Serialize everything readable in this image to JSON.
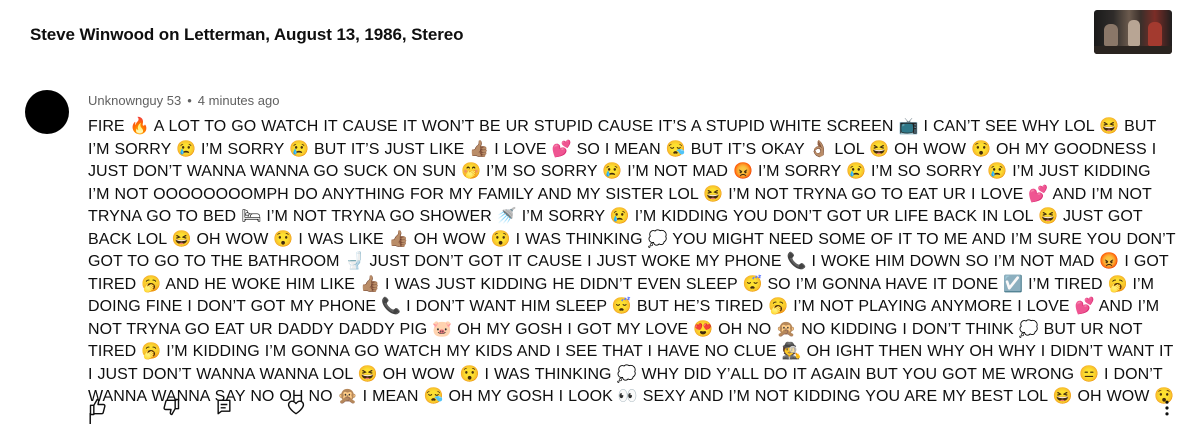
{
  "video": {
    "title": "Steve Winwood on Letterman, August 13, 1986, Stereo",
    "thumbnail_icon": "video-thumbnail"
  },
  "comment": {
    "author": "Unknownguy 53",
    "separator": "•",
    "time": "4 minutes ago",
    "text": "FIRE 🔥 A LOT TO GO WATCH IT CAUSE IT WON’T BE UR STUPID CAUSE IT’S A STUPID WHITE SCREEN 📺 I CAN’T SEE WHY LOL 😆 BUT I’M SORRY 😢 I’M SORRY 😢 BUT IT’S JUST LIKE 👍🏽 I LOVE 💕 SO I MEAN 😪 BUT IT’S OKAY 👌🏽 LOL 😆 OH WOW 😯 OH MY GOODNESS I JUST DON’T WANNA WANNA GO SUCK ON SUN 🤭 I’M SO SORRY 😢 I’M NOT MAD 😡 I’M SORRY 😢 I’M SO SORRY 😢 I’M JUST KIDDING I’M NOT OOOOOOOOMPH DO ANYTHING FOR MY FAMILY AND MY SISTER LOL 😆 I’M NOT TRYNA GO TO EAT UR I LOVE 💕 AND I’M NOT TRYNA GO TO BED 🛏 I’M NOT TRYNA GO SHOWER 🚿 I’M SORRY 😢 I’M KIDDING YOU DON’T GOT UR LIFE BACK IN LOL 😆 JUST GOT BACK LOL 😆 OH WOW 😯 I WAS LIKE 👍🏽 OH WOW 😯 I WAS THINKING 💭 YOU MIGHT NEED SOME OF IT TO ME AND I’M SURE YOU DON’T GOT TO GO TO THE BATHROOM 🚽 JUST DON’T GOT IT CAUSE I JUST WOKE MY PHONE 📞 I WOKE HIM DOWN SO I’M NOT MAD 😡 I GOT TIRED 🥱 AND HE WOKE HIM LIKE 👍🏽 I WAS JUST KIDDING HE DIDN’T EVEN SLEEP 😴 SO I’M GONNA HAVE IT DONE ☑️ I’M TIRED 🥱 I’M DOING FINE I DON’T GOT MY PHONE 📞 I DON’T WANT HIM SLEEP 😴 BUT HE’S TIRED 🥱 I’M NOT PLAYING ANYMORE I LOVE 💕 AND I’M NOT TRYNA GO EAT UR DADDY DADDY PIG 🐷 OH MY GOSH I GOT MY LOVE 😍 OH NO 🙊 NO KIDDING I DON’T THINK 💭 BUT UR NOT TIRED 🥱 I’M KIDDING I’M GONNA GO WATCH MY KIDS AND I SEE THAT I HAVE NO CLUE 🕵️ OH IGHT THEN WHY OH WHY I DIDN’T WANT IT I JUST DON’T WANNA WANNA LOL 😆 OH WOW 😯 I WAS THINKING 💭 WHY DID Y’ALL DO IT AGAIN BUT YOU GOT ME WRONG 😑 I DON’T WANNA WANNA SAY NO OH NO 🙊 I MEAN 😪 OH MY GOSH I LOOK 👀 SEXY AND I’M NOT KIDDING YOU ARE MY BEST LOL 😆 OH WOW 😯 I"
  },
  "actions": {
    "like_icon": "thumbs-up-icon",
    "dislike_icon": "thumbs-down-icon",
    "reply_icon": "reply-icon",
    "heart_icon": "heart-icon",
    "more_icon": "more-vertical-icon"
  }
}
